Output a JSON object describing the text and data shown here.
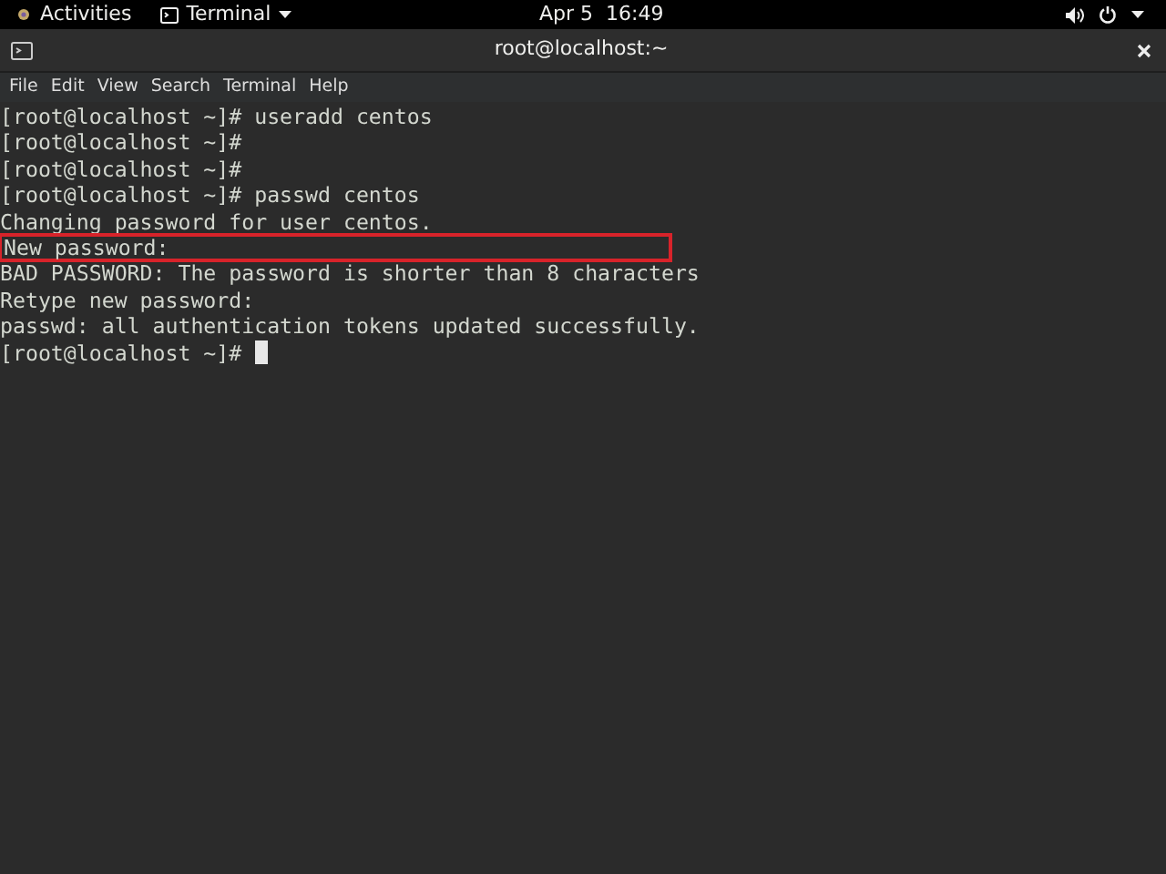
{
  "top_bar": {
    "activities": "Activities",
    "app_menu": "Terminal",
    "clock": "Apr 5  16:49"
  },
  "window": {
    "title": "root@localhost:~"
  },
  "menu": [
    "File",
    "Edit",
    "View",
    "Search",
    "Terminal",
    "Help"
  ],
  "terminal": {
    "lines": [
      {
        "text": "[root@localhost ~]# useradd centos",
        "highlighted": false,
        "cursor": false
      },
      {
        "text": "[root@localhost ~]#",
        "highlighted": false,
        "cursor": false
      },
      {
        "text": "[root@localhost ~]#",
        "highlighted": false,
        "cursor": false
      },
      {
        "text": "[root@localhost ~]# passwd centos",
        "highlighted": false,
        "cursor": false
      },
      {
        "text": "Changing password for user centos.",
        "highlighted": false,
        "cursor": false
      },
      {
        "text": "New password:",
        "highlighted": true,
        "cursor": false
      },
      {
        "text": "BAD PASSWORD: The password is shorter than 8 characters",
        "highlighted": false,
        "cursor": false
      },
      {
        "text": "Retype new password:",
        "highlighted": false,
        "cursor": false
      },
      {
        "text": "passwd: all authentication tokens updated successfully.",
        "highlighted": false,
        "cursor": false
      },
      {
        "text": "[root@localhost ~]#",
        "highlighted": false,
        "cursor": true
      }
    ]
  }
}
